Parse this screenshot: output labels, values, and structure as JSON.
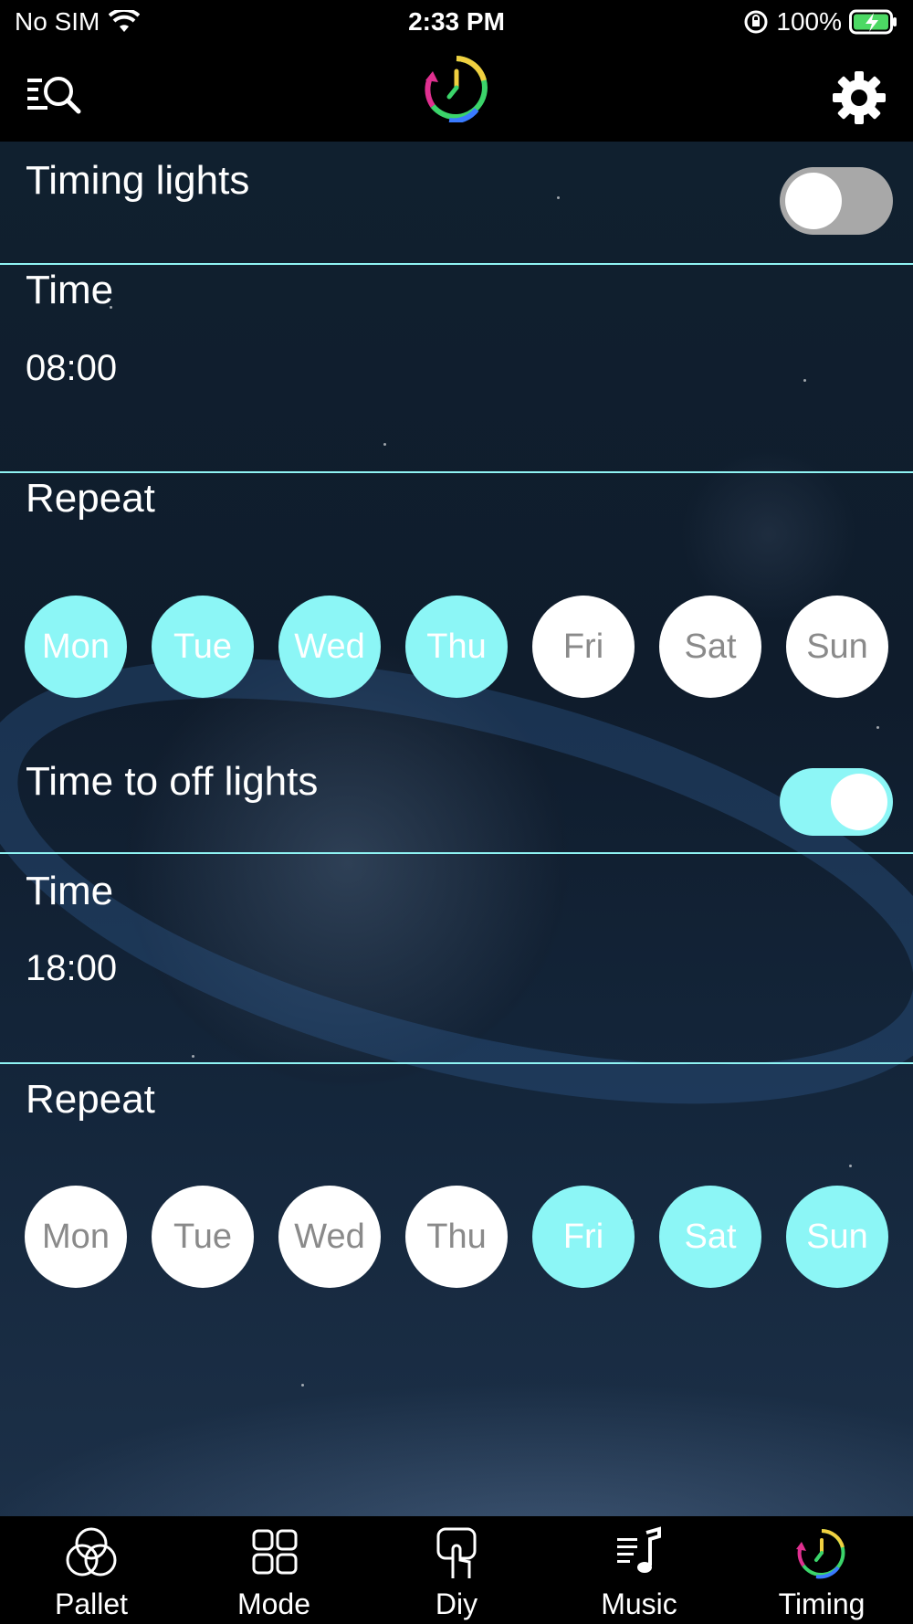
{
  "status_bar": {
    "carrier": "No SIM",
    "time": "2:33 PM",
    "battery": "100%"
  },
  "nav": {
    "menu_icon": "menu-search-icon",
    "logo_icon": "timing-logo-icon",
    "settings_icon": "gear-icon"
  },
  "timing_on": {
    "label": "Timing lights",
    "enabled": false,
    "time_label": "Time",
    "time_value": "08:00",
    "repeat_label": "Repeat",
    "days": [
      {
        "label": "Mon",
        "selected": true
      },
      {
        "label": "Tue",
        "selected": true
      },
      {
        "label": "Wed",
        "selected": true
      },
      {
        "label": "Thu",
        "selected": true
      },
      {
        "label": "Fri",
        "selected": false
      },
      {
        "label": "Sat",
        "selected": false
      },
      {
        "label": "Sun",
        "selected": false
      }
    ]
  },
  "timing_off": {
    "label": "Time to off lights",
    "enabled": true,
    "time_label": "Time",
    "time_value": "18:00",
    "repeat_label": "Repeat",
    "days": [
      {
        "label": "Mon",
        "selected": false
      },
      {
        "label": "Tue",
        "selected": false
      },
      {
        "label": "Wed",
        "selected": false
      },
      {
        "label": "Thu",
        "selected": false
      },
      {
        "label": "Fri",
        "selected": true
      },
      {
        "label": "Sat",
        "selected": true
      },
      {
        "label": "Sun",
        "selected": true
      }
    ]
  },
  "colors": {
    "accent": "#8cf6f6",
    "divider": "#8ff3f3",
    "toggle_off": "#a8a8a8"
  },
  "tabs": [
    {
      "label": "Pallet",
      "icon": "pallet-icon"
    },
    {
      "label": "Mode",
      "icon": "mode-grid-icon"
    },
    {
      "label": "Diy",
      "icon": "diy-touch-icon"
    },
    {
      "label": "Music",
      "icon": "music-icon"
    },
    {
      "label": "Timing",
      "icon": "timing-icon"
    }
  ]
}
